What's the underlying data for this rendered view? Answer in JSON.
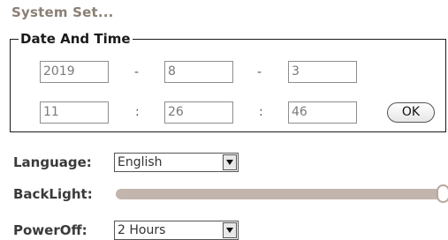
{
  "title": "System Set...",
  "date_time": {
    "legend": "Date And Time",
    "year": "2019",
    "month": "8",
    "day": "3",
    "hour": "11",
    "minute": "26",
    "second": "46",
    "date_separator": "-",
    "time_separator": ":",
    "ok_label": "OK"
  },
  "language": {
    "label": "Language:",
    "selected": "English"
  },
  "backlight": {
    "label": "BackLight:",
    "level_percent": 100
  },
  "power_off": {
    "label": "PowerOff:",
    "selected": "2 Hours"
  },
  "colors": {
    "title": "#8a7f74",
    "slider_track": "#c2b5ad"
  },
  "icons": {
    "dropdown": "triangle-down-icon"
  }
}
